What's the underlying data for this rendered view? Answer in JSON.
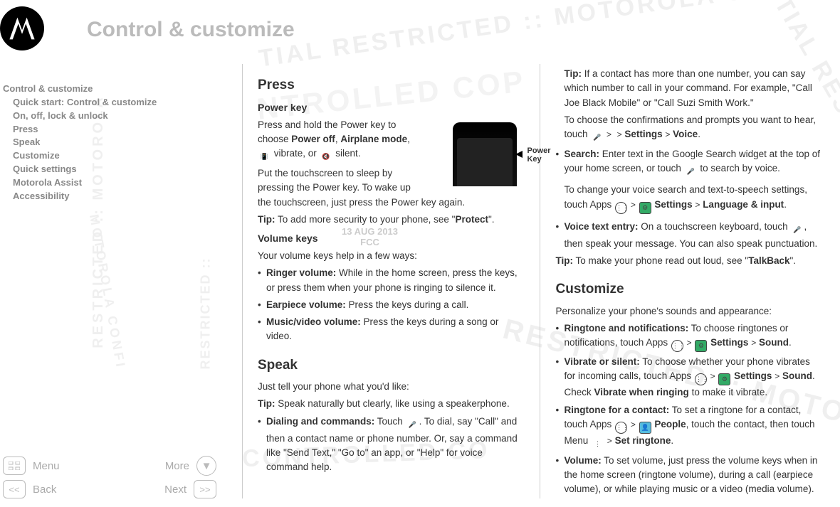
{
  "header": {
    "title": "Control & customize"
  },
  "sidebar": {
    "items": [
      {
        "label": "Control & customize",
        "indent": 0
      },
      {
        "label": "Quick start: Control & customize",
        "indent": 1
      },
      {
        "label": "On, off, lock & unlock",
        "indent": 1
      },
      {
        "label": "Press",
        "indent": 1
      },
      {
        "label": "Speak",
        "indent": 1
      },
      {
        "label": "Customize",
        "indent": 1
      },
      {
        "label": "Quick settings",
        "indent": 1
      },
      {
        "label": "Motorola Assist",
        "indent": 1
      },
      {
        "label": "Accessibility",
        "indent": 1
      }
    ]
  },
  "nav": {
    "menu": "Menu",
    "more": "More",
    "back": "Back",
    "next": "Next"
  },
  "watermark_date": "13 AUG 2013",
  "watermark_org": "FCC",
  "col1": {
    "h_press": "Press",
    "h_powerkey": "Power key",
    "powerkey_p1a": "Press and hold the Power key to choose ",
    "b_poweroff": "Power off",
    "sep": ", ",
    "b_airplane": "Airplane mode",
    "powerkey_p1b": ", ",
    "vibrate": " vibrate, or ",
    "silent": " silent.",
    "powerkey_p2": "Put the touchscreen to sleep by pressing the Power key. To wake up the touchscreen, just press the Power key again.",
    "tip1a": "Tip:",
    "tip1b": " To add more security to your phone, see \"",
    "b_protect": "Protect",
    "tip1c": "\".",
    "h_volume": "Volume keys",
    "vol_p": "Your volume keys help in a few ways:",
    "b_ringer": "Ringer volume:",
    "ringer_t": " While in the home screen, press the keys, or press them when your phone is ringing to silence it.",
    "b_earpiece": "Earpiece volume:",
    "earpiece_t": " Press the keys during a call.",
    "b_music": "Music/video volume:",
    "music_t": " Press the keys during a song or video.",
    "h_speak": "Speak",
    "speak_p": "Just tell your phone what you'd like:",
    "tip2a": "Tip:",
    "tip2b": " Speak naturally but clearly, like using a speakerphone.",
    "b_dial": "Dialing and commands:",
    "dial_t": " Touch  . To dial, say \"Call\" and then a contact name or phone number. Or, say a command like \"Send Text,\" \"Go to\" an app, or \"Help\" for voice command help.",
    "phone_label1": "Power",
    "phone_label2": "Key"
  },
  "col2": {
    "tip1a": "Tip:",
    "tip1b": " If a contact has more than one number, you can say which number to call in your command. For example, \"Call Joe Black Mobile\" or \"Call Suzi Smith Work.\"",
    "confirm_p1": "To choose the confirmations and prompts you want to hear, touch ",
    "arrow": " > ",
    "b_settings": "Settings",
    "b_voice": "Voice",
    "confirm_p2": ".",
    "b_search": "Search:",
    "search_t": " Enter text in the Google Search widget at the top of your home screen, or touch   to search by voice.",
    "voice_settings_p": "To change your voice search and text-to-speech settings, touch Apps ",
    "b_lang": "Language & input",
    "b_vte": "Voice text entry:",
    "vte_t": " On a touchscreen keyboard, touch  , then speak your message. You can also speak punctuation.",
    "tip2a": "Tip:",
    "tip2b": " To make your phone read out loud, see \"",
    "b_talkback": "TalkBack",
    "tip2c": "\".",
    "h_customize": "Customize",
    "cust_p": "Personalize your phone's sounds and appearance:",
    "b_ring": "Ringtone and notifications:",
    "ring_t": " To choose ringtones or notifications, touch Apps ",
    "b_sound": "Sound",
    "b_vib": "Vibrate or silent:",
    "vib_t1": " To choose whether your phone vibrates for incoming calls, touch Apps ",
    "vib_t2": ". Check ",
    "b_vwr": "Vibrate when ringing",
    "vib_t3": " to make it vibrate.",
    "b_rfc": "Ringtone for a contact:",
    "rfc_t1": " To set a ringtone for a contact, touch Apps ",
    "b_people": "People",
    "rfc_t2": ", touch the contact, then touch Menu ",
    "b_setring": "Set ringtone",
    "b_vol": "Volume:",
    "vol_t": " To set volume, just press the volume keys when in the home screen (ringtone volume), during a call (earpiece volume), or while playing music or a video (media volume)."
  }
}
